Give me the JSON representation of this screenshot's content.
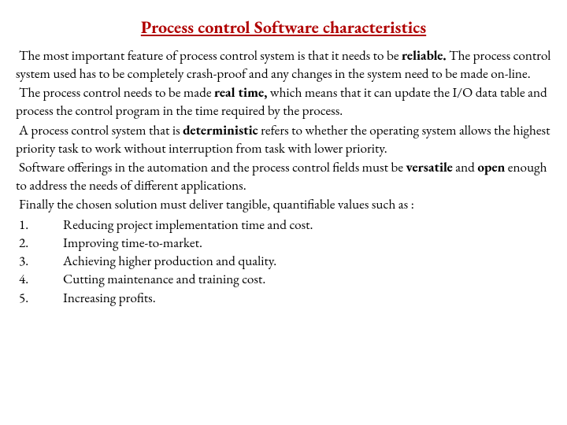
{
  "title": "Process control Software characteristics",
  "paragraphs": {
    "p1a": "The most important feature of process control system is that it needs to be ",
    "p1b": "reliable.",
    "p1c": " The process control system used has to be completely crash-proof and any changes in the system need to be made on-line.",
    "p2a": "The process control needs to be made ",
    "p2b": "real time,",
    "p2c": " which means that it can update the I/O data table and process the control program in the time required by the process.",
    "p3a": "A process control system that is ",
    "p3b": "deterministic",
    "p3c": " refers to whether the operating system allows the highest priority task to work without interruption from task with lower priority.",
    "p4a": "Software offerings in the automation and the process control fields must be ",
    "p4b": "versatile",
    "p4c": " and ",
    "p4d": "open",
    "p4e": " enough to address the needs of different applications.",
    "p5": "Finally the chosen solution must deliver tangible, quantifiable values such as :"
  },
  "list": {
    "i1": "Reducing project implementation time and cost.",
    "i2": "Improving time-to-market.",
    "i3": "Achieving higher production and quality.",
    "i4": "Cutting maintenance and training cost.",
    "i5": "Increasing profits."
  }
}
